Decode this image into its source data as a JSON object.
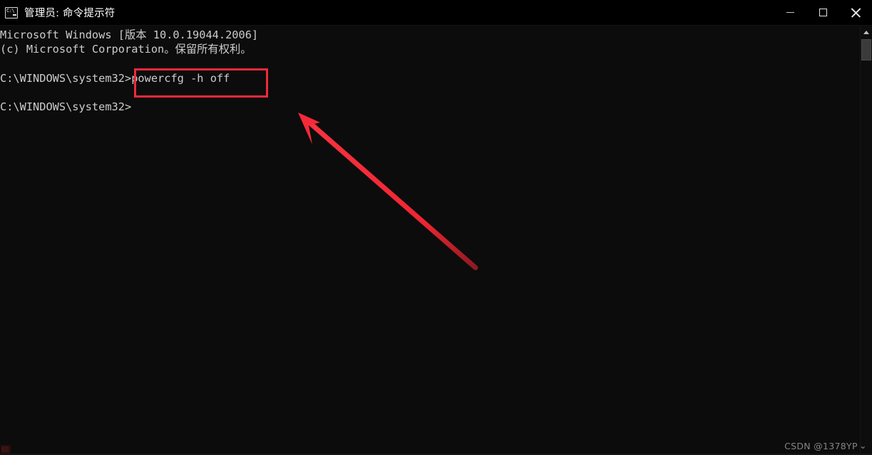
{
  "window": {
    "title": "管理员: 命令提示符",
    "icon": "cmd-console-icon",
    "background_color": "#0c0c0c",
    "titlebar_color": "#000000",
    "controls": {
      "minimize_label": "—",
      "maximize_label": "□",
      "close_label": "✕"
    }
  },
  "console": {
    "text_color": "#cccccc",
    "lines": [
      "Microsoft Windows [版本 10.0.19044.2006]",
      "(c) Microsoft Corporation。保留所有权利。",
      "",
      "C:\\WINDOWS\\system32>powercfg -h off",
      "",
      "C:\\WINDOWS\\system32>"
    ],
    "full_text": "Microsoft Windows [版本 10.0.19044.2006]\n(c) Microsoft Corporation。保留所有权利。\n\nC:\\WINDOWS\\system32>powercfg -h off\n\nC:\\WINDOWS\\system32>"
  },
  "annotations": {
    "highlight_color": "#ee2a3c",
    "highlight_target": "powercfg -h off",
    "arrow_color": "#f42a38",
    "arrow_points_to": "highlighted-command"
  },
  "scrollbar": {
    "up_arrow": "scroll-up-arrow",
    "thumb_color": "#3b3b3b"
  },
  "watermark": {
    "text": "CSDN @1378YP",
    "chevron": "⌄"
  }
}
